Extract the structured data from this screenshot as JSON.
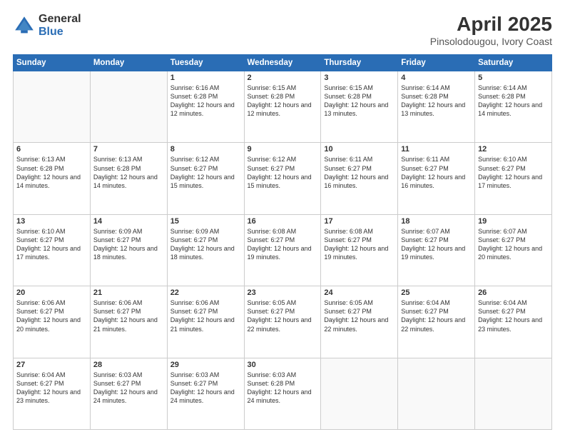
{
  "logo": {
    "general": "General",
    "blue": "Blue"
  },
  "header": {
    "month": "April 2025",
    "location": "Pinsolodougou, Ivory Coast"
  },
  "weekdays": [
    "Sunday",
    "Monday",
    "Tuesday",
    "Wednesday",
    "Thursday",
    "Friday",
    "Saturday"
  ],
  "weeks": [
    [
      {
        "day": "",
        "info": ""
      },
      {
        "day": "",
        "info": ""
      },
      {
        "day": "1",
        "info": "Sunrise: 6:16 AM\nSunset: 6:28 PM\nDaylight: 12 hours and 12 minutes."
      },
      {
        "day": "2",
        "info": "Sunrise: 6:15 AM\nSunset: 6:28 PM\nDaylight: 12 hours and 12 minutes."
      },
      {
        "day": "3",
        "info": "Sunrise: 6:15 AM\nSunset: 6:28 PM\nDaylight: 12 hours and 13 minutes."
      },
      {
        "day": "4",
        "info": "Sunrise: 6:14 AM\nSunset: 6:28 PM\nDaylight: 12 hours and 13 minutes."
      },
      {
        "day": "5",
        "info": "Sunrise: 6:14 AM\nSunset: 6:28 PM\nDaylight: 12 hours and 14 minutes."
      }
    ],
    [
      {
        "day": "6",
        "info": "Sunrise: 6:13 AM\nSunset: 6:28 PM\nDaylight: 12 hours and 14 minutes."
      },
      {
        "day": "7",
        "info": "Sunrise: 6:13 AM\nSunset: 6:28 PM\nDaylight: 12 hours and 14 minutes."
      },
      {
        "day": "8",
        "info": "Sunrise: 6:12 AM\nSunset: 6:27 PM\nDaylight: 12 hours and 15 minutes."
      },
      {
        "day": "9",
        "info": "Sunrise: 6:12 AM\nSunset: 6:27 PM\nDaylight: 12 hours and 15 minutes."
      },
      {
        "day": "10",
        "info": "Sunrise: 6:11 AM\nSunset: 6:27 PM\nDaylight: 12 hours and 16 minutes."
      },
      {
        "day": "11",
        "info": "Sunrise: 6:11 AM\nSunset: 6:27 PM\nDaylight: 12 hours and 16 minutes."
      },
      {
        "day": "12",
        "info": "Sunrise: 6:10 AM\nSunset: 6:27 PM\nDaylight: 12 hours and 17 minutes."
      }
    ],
    [
      {
        "day": "13",
        "info": "Sunrise: 6:10 AM\nSunset: 6:27 PM\nDaylight: 12 hours and 17 minutes."
      },
      {
        "day": "14",
        "info": "Sunrise: 6:09 AM\nSunset: 6:27 PM\nDaylight: 12 hours and 18 minutes."
      },
      {
        "day": "15",
        "info": "Sunrise: 6:09 AM\nSunset: 6:27 PM\nDaylight: 12 hours and 18 minutes."
      },
      {
        "day": "16",
        "info": "Sunrise: 6:08 AM\nSunset: 6:27 PM\nDaylight: 12 hours and 19 minutes."
      },
      {
        "day": "17",
        "info": "Sunrise: 6:08 AM\nSunset: 6:27 PM\nDaylight: 12 hours and 19 minutes."
      },
      {
        "day": "18",
        "info": "Sunrise: 6:07 AM\nSunset: 6:27 PM\nDaylight: 12 hours and 19 minutes."
      },
      {
        "day": "19",
        "info": "Sunrise: 6:07 AM\nSunset: 6:27 PM\nDaylight: 12 hours and 20 minutes."
      }
    ],
    [
      {
        "day": "20",
        "info": "Sunrise: 6:06 AM\nSunset: 6:27 PM\nDaylight: 12 hours and 20 minutes."
      },
      {
        "day": "21",
        "info": "Sunrise: 6:06 AM\nSunset: 6:27 PM\nDaylight: 12 hours and 21 minutes."
      },
      {
        "day": "22",
        "info": "Sunrise: 6:06 AM\nSunset: 6:27 PM\nDaylight: 12 hours and 21 minutes."
      },
      {
        "day": "23",
        "info": "Sunrise: 6:05 AM\nSunset: 6:27 PM\nDaylight: 12 hours and 22 minutes."
      },
      {
        "day": "24",
        "info": "Sunrise: 6:05 AM\nSunset: 6:27 PM\nDaylight: 12 hours and 22 minutes."
      },
      {
        "day": "25",
        "info": "Sunrise: 6:04 AM\nSunset: 6:27 PM\nDaylight: 12 hours and 22 minutes."
      },
      {
        "day": "26",
        "info": "Sunrise: 6:04 AM\nSunset: 6:27 PM\nDaylight: 12 hours and 23 minutes."
      }
    ],
    [
      {
        "day": "27",
        "info": "Sunrise: 6:04 AM\nSunset: 6:27 PM\nDaylight: 12 hours and 23 minutes."
      },
      {
        "day": "28",
        "info": "Sunrise: 6:03 AM\nSunset: 6:27 PM\nDaylight: 12 hours and 24 minutes."
      },
      {
        "day": "29",
        "info": "Sunrise: 6:03 AM\nSunset: 6:27 PM\nDaylight: 12 hours and 24 minutes."
      },
      {
        "day": "30",
        "info": "Sunrise: 6:03 AM\nSunset: 6:28 PM\nDaylight: 12 hours and 24 minutes."
      },
      {
        "day": "",
        "info": ""
      },
      {
        "day": "",
        "info": ""
      },
      {
        "day": "",
        "info": ""
      }
    ]
  ]
}
